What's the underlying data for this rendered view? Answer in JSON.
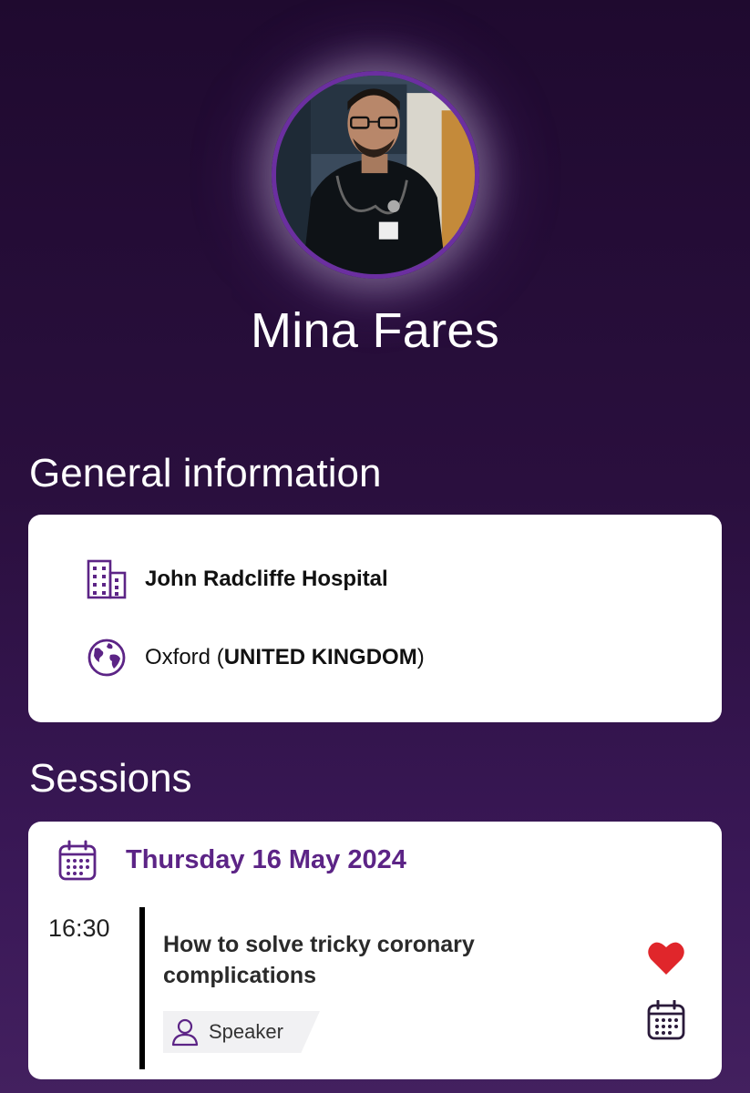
{
  "profile": {
    "name": "Mina Fares"
  },
  "general": {
    "title": "General information",
    "institution": "John Radcliffe Hospital",
    "city": "Oxford",
    "country": "UNITED KINGDOM",
    "paren_open": " (",
    "paren_close": ")"
  },
  "sessions": {
    "title": "Sessions",
    "date": "Thursday 16 May 2024",
    "items": [
      {
        "time": "16:30",
        "title": "How to solve tricky coronary complications",
        "role": "Speaker"
      }
    ]
  },
  "icons": {
    "institution": "building-icon",
    "location": "globe-icon",
    "date": "calendar-icon",
    "role": "person-icon",
    "favorite": "heart-icon",
    "add_to_calendar": "calendar-add-icon"
  },
  "colors": {
    "accent": "#5c2486",
    "heart": "#e0262b",
    "background_top": "#1f0a2f",
    "background_bottom": "#43205f"
  }
}
